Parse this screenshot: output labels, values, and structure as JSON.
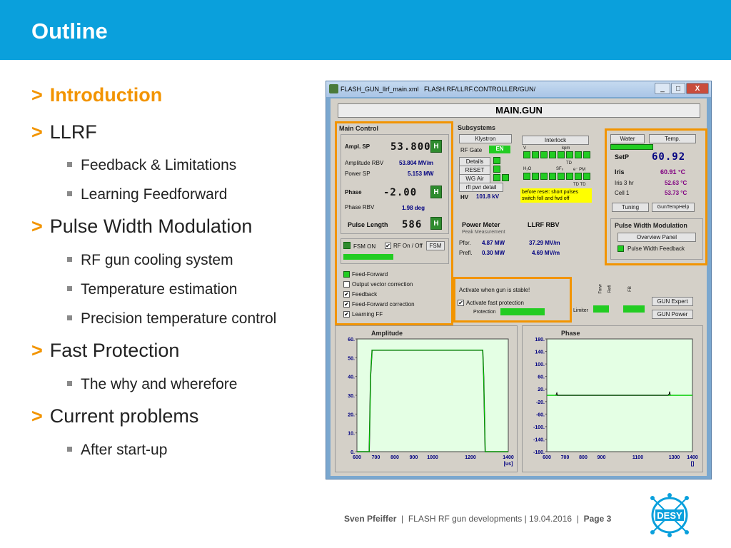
{
  "slide": {
    "title": "Outline",
    "bullets": [
      {
        "level": 1,
        "text": "Introduction",
        "active": true
      },
      {
        "level": 1,
        "text": "LLRF"
      },
      {
        "level": 2,
        "text": "Feedback & Limitations"
      },
      {
        "level": 2,
        "text": "Learning Feedforward"
      },
      {
        "level": 1,
        "text": "Pulse Width Modulation"
      },
      {
        "level": 2,
        "text": "RF gun cooling system"
      },
      {
        "level": 2,
        "text": "Temperature estimation"
      },
      {
        "level": 2,
        "text": "Precision temperature control"
      },
      {
        "level": 1,
        "text": "Fast Protection"
      },
      {
        "level": 2,
        "text": "The why and wherefore"
      },
      {
        "level": 1,
        "text": "Current problems"
      },
      {
        "level": 2,
        "text": "After start-up"
      }
    ],
    "arrow": ">",
    "footer": {
      "author": "Sven Pfeiffer",
      "sep1": "|",
      "topic": "FLASH RF gun developments | 19.04.2016",
      "sep2": "|",
      "page": "Page 3"
    },
    "logo_text": "DESY",
    "colors": {
      "header": "#0aa0dc",
      "accent": "#f29400",
      "led_green": "#22cc22"
    }
  },
  "window": {
    "file": "FLASH_GUN_llrf_main.xml",
    "path": "FLASH.RF/LLRF.CONTROLLER/GUN/",
    "btn_min": "_",
    "btn_max": "□",
    "btn_close": "X",
    "main_title": "MAIN.GUN",
    "main_control": {
      "title": "Main Control",
      "ampl_sp_label": "Ampl. SP",
      "ampl_sp_value": "53.800",
      "amplitude_rbv_label": "Amplitude RBV",
      "amplitude_rbv_value": "53.804 MV/m",
      "power_sp_label": "Power SP",
      "power_sp_value": "5.153 MW",
      "phase_label": "Phase",
      "phase_value": "-2.00",
      "phase_rbv_label": "Phase RBV",
      "phase_rbv_value": "1.98 deg",
      "pulse_length_label": "Pulse Length",
      "pulse_length_value": "586",
      "h": "H",
      "fsm_on": "FSM ON",
      "rf_onoff": "RF On / Off",
      "fsm_btn": "FSM",
      "checks": [
        {
          "label": "Feed-Forward",
          "state": "green"
        },
        {
          "label": "Output vector correction",
          "state": "off"
        },
        {
          "label": "Feedback",
          "state": "on"
        },
        {
          "label": "Feed-Forward correction",
          "state": "on"
        },
        {
          "label": "Learning FF",
          "state": "on"
        }
      ],
      "check_mark": "✔"
    },
    "subsystems": {
      "title": "Subsystems",
      "klystron": "Klystron",
      "rf_gate": "RF Gate",
      "en": "EN",
      "details": "Details",
      "reset": "RESET",
      "wg_air": "WG Air",
      "rfl_pwr": "rfl pwr detail",
      "hv_label": "HV",
      "hv_value": "101.8 kV",
      "interlock": "Interlock",
      "v": "V",
      "kpm": "kpm",
      "h2o": "H₂O",
      "sf6": "SF₆",
      "epm": "e⁻ PM",
      "td": "TD",
      "td2": "TD TD",
      "note": "before reset: short pulses switch foll and fwd off"
    },
    "power_meter": {
      "title": "Power Meter",
      "subtitle": "Peak Measurement",
      "pfor_label": "Pfor.",
      "pfor_value": "4.87 MW",
      "prefl_label": "Prefl.",
      "prefl_value": "0.30 MW"
    },
    "llrf_rbv": {
      "title": "LLRF RBV",
      "v1": "37.29 MV/m",
      "v2": "4.69 MV/m"
    },
    "water": {
      "water": "Water",
      "temp": "Temp.",
      "setp_label": "SetP",
      "setp_value": "60.92",
      "iris_label": "Iris",
      "iris_value": "60.91 °C",
      "iris3_label": "Iris 3 hr",
      "iris3_value": "52.63 °C",
      "cell1_label": "Cell 1",
      "cell1_value": "53.73 °C",
      "tuning": "Tuning",
      "guntemphelp": "GunTempHelp"
    },
    "pwm": {
      "title": "Pulse Width Modulation",
      "overview": "Overview Panel",
      "feedback": "Pulse Width Feedback"
    },
    "protection": {
      "title": "Activate when gun is stable!",
      "fast": "Activate fast protection",
      "protection": "Protection",
      "limiter": "Limiter",
      "forw": "Forw",
      "refl": "Refl",
      "fb": "FB",
      "gun_expert": "GUN Expert",
      "gun_power": "GUN Power"
    }
  },
  "chart_data": [
    {
      "type": "line",
      "title": "Amplitude",
      "xlabel": "[us]",
      "xlim": [
        600,
        1400
      ],
      "ylim": [
        0,
        60
      ],
      "xticks": [
        600,
        700,
        800,
        900,
        1000,
        1200,
        1400
      ],
      "yticks": [
        "0.",
        "10.",
        "20.",
        "30.",
        "40.",
        "50.",
        "60."
      ],
      "grid": false,
      "series": [
        {
          "color": "#000000",
          "x": [
            600,
            665,
            672,
            680,
            1265,
            1270,
            1278,
            1400
          ],
          "y": [
            0,
            0,
            40,
            54,
            54,
            40,
            0,
            0
          ]
        },
        {
          "color": "#00cc00",
          "x": [
            600,
            665,
            672,
            680,
            1265,
            1270,
            1278,
            1400
          ],
          "y": [
            0,
            0,
            40,
            54,
            54,
            40,
            0,
            0
          ]
        }
      ]
    },
    {
      "type": "line",
      "title": "Phase",
      "xlabel": "[]",
      "xlim": [
        600,
        1400
      ],
      "ylim": [
        -180,
        180
      ],
      "xticks": [
        600,
        700,
        800,
        900,
        1100,
        1300,
        1400
      ],
      "yticks": [
        "-180.",
        "-140.",
        "-100.",
        "-60.",
        "-20.",
        "20.",
        "60.",
        "100.",
        "140.",
        "180."
      ],
      "grid": false,
      "series": [
        {
          "color": "#00cc00",
          "x": [
            600,
            1400
          ],
          "y": [
            0,
            0
          ]
        },
        {
          "color": "#000000",
          "x": [
            650,
            655,
            658,
            665,
            1265,
            1272,
            1275,
            1278
          ],
          "y": [
            0,
            8,
            0,
            0,
            0,
            4,
            12,
            0
          ]
        }
      ]
    }
  ]
}
